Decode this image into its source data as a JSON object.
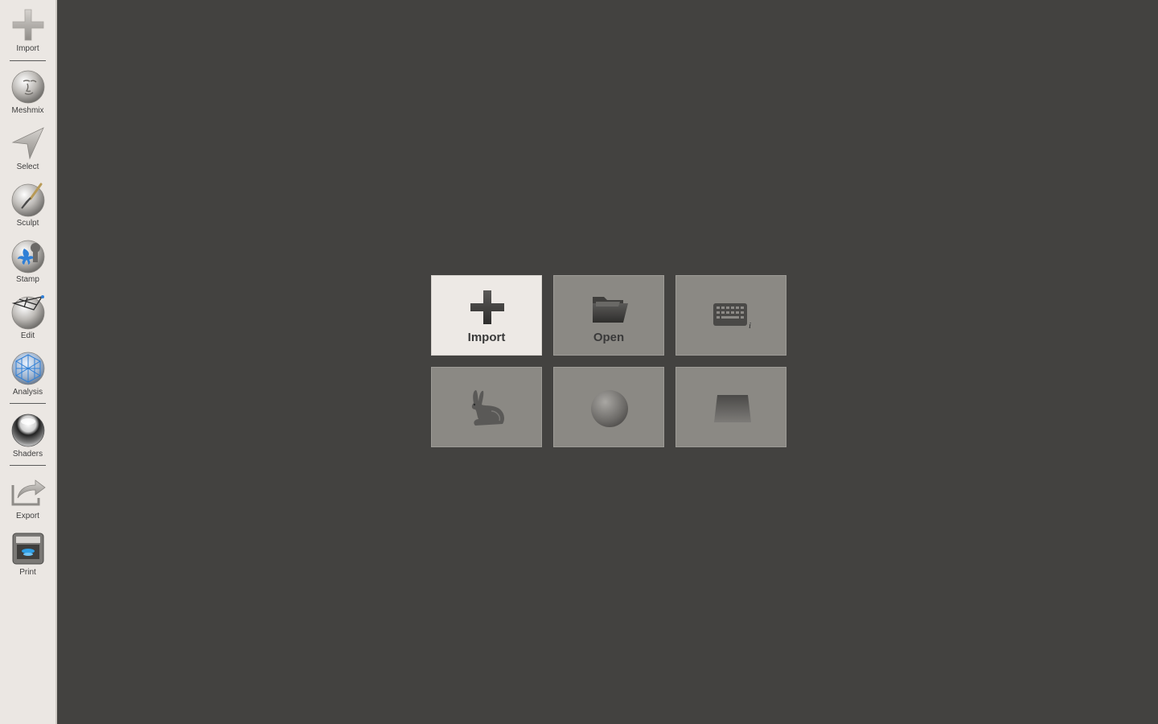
{
  "sidebar": {
    "tools": [
      {
        "label": "Import",
        "icon": "plus-icon"
      },
      {
        "label": "Meshmix",
        "icon": "meshmix-face-sphere-icon"
      },
      {
        "label": "Select",
        "icon": "select-arrow-icon"
      },
      {
        "label": "Sculpt",
        "icon": "sculpt-brush-sphere-icon"
      },
      {
        "label": "Stamp",
        "icon": "stamp-sphere-icon"
      },
      {
        "label": "Edit",
        "icon": "edit-wireframe-sphere-icon"
      },
      {
        "label": "Analysis",
        "icon": "analysis-mesh-sphere-icon"
      },
      {
        "label": "Shaders",
        "icon": "shaders-chrome-sphere-icon"
      },
      {
        "label": "Export",
        "icon": "export-arrow-icon"
      },
      {
        "label": "Print",
        "icon": "printer-icon"
      }
    ]
  },
  "start_tiles": [
    {
      "label": "Import",
      "icon": "plus-icon",
      "active": true
    },
    {
      "label": "Open",
      "icon": "folder-icon"
    },
    {
      "label": "",
      "icon": "keyboard-info-icon"
    },
    {
      "label": "",
      "icon": "bunny-icon"
    },
    {
      "label": "",
      "icon": "sphere-icon"
    },
    {
      "label": "",
      "icon": "plane-icon"
    }
  ],
  "colors": {
    "sidebar_bg": "#ebe7e3",
    "viewport_bg": "#434240",
    "tile_bg": "#8b8984",
    "tile_active_bg": "#ede9e5"
  }
}
